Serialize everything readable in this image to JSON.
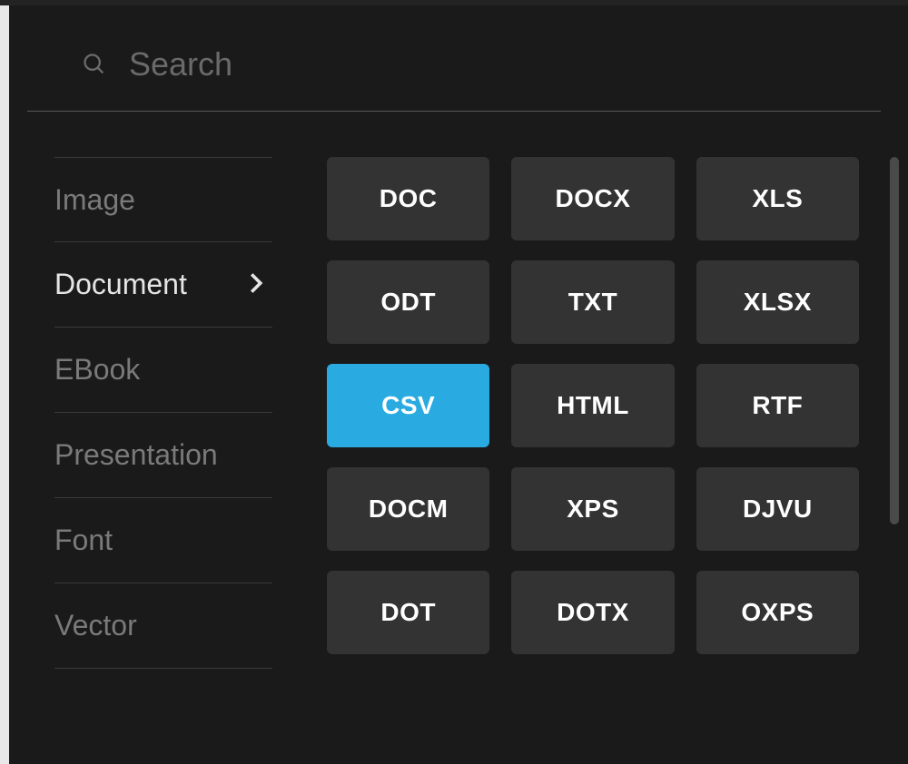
{
  "search": {
    "placeholder": "Search",
    "value": ""
  },
  "sidebar": {
    "items": [
      {
        "label": "Image",
        "selected": false
      },
      {
        "label": "Document",
        "selected": true
      },
      {
        "label": "EBook",
        "selected": false
      },
      {
        "label": "Presentation",
        "selected": false
      },
      {
        "label": "Font",
        "selected": false
      },
      {
        "label": "Vector",
        "selected": false
      }
    ]
  },
  "formats": {
    "items": [
      {
        "label": "DOC",
        "selected": false
      },
      {
        "label": "DOCX",
        "selected": false
      },
      {
        "label": "XLS",
        "selected": false
      },
      {
        "label": "ODT",
        "selected": false
      },
      {
        "label": "TXT",
        "selected": false
      },
      {
        "label": "XLSX",
        "selected": false
      },
      {
        "label": "CSV",
        "selected": true
      },
      {
        "label": "HTML",
        "selected": false
      },
      {
        "label": "RTF",
        "selected": false
      },
      {
        "label": "DOCM",
        "selected": false
      },
      {
        "label": "XPS",
        "selected": false
      },
      {
        "label": "DJVU",
        "selected": false
      },
      {
        "label": "DOT",
        "selected": false
      },
      {
        "label": "DOTX",
        "selected": false
      },
      {
        "label": "OXPS",
        "selected": false
      }
    ]
  },
  "colors": {
    "accent": "#29abe2",
    "background": "#1a1a1a",
    "button_bg": "#333333"
  }
}
